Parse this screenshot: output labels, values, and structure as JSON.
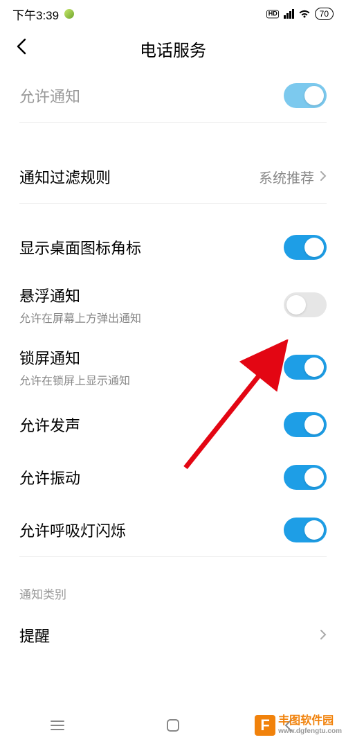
{
  "status": {
    "time": "下午3:39",
    "battery": "70"
  },
  "page": {
    "title": "电话服务"
  },
  "rows": {
    "allow_notify": {
      "label": "允许通知"
    },
    "filter_rules": {
      "label": "通知过滤规则",
      "value": "系统推荐"
    },
    "desktop_badge": {
      "label": "显示桌面图标角标"
    },
    "float_notify": {
      "label": "悬浮通知",
      "desc": "允许在屏幕上方弹出通知"
    },
    "lock_notify": {
      "label": "锁屏通知",
      "desc": "允许在锁屏上显示通知"
    },
    "allow_sound": {
      "label": "允许发声"
    },
    "allow_vibrate": {
      "label": "允许振动"
    },
    "allow_breath": {
      "label": "允许呼吸灯闪烁"
    },
    "category_title": "通知类别",
    "reminder": {
      "label": "提醒"
    }
  },
  "watermark": {
    "logo": "F",
    "name": "丰图软件园",
    "url": "www.dgfengtu.com"
  }
}
